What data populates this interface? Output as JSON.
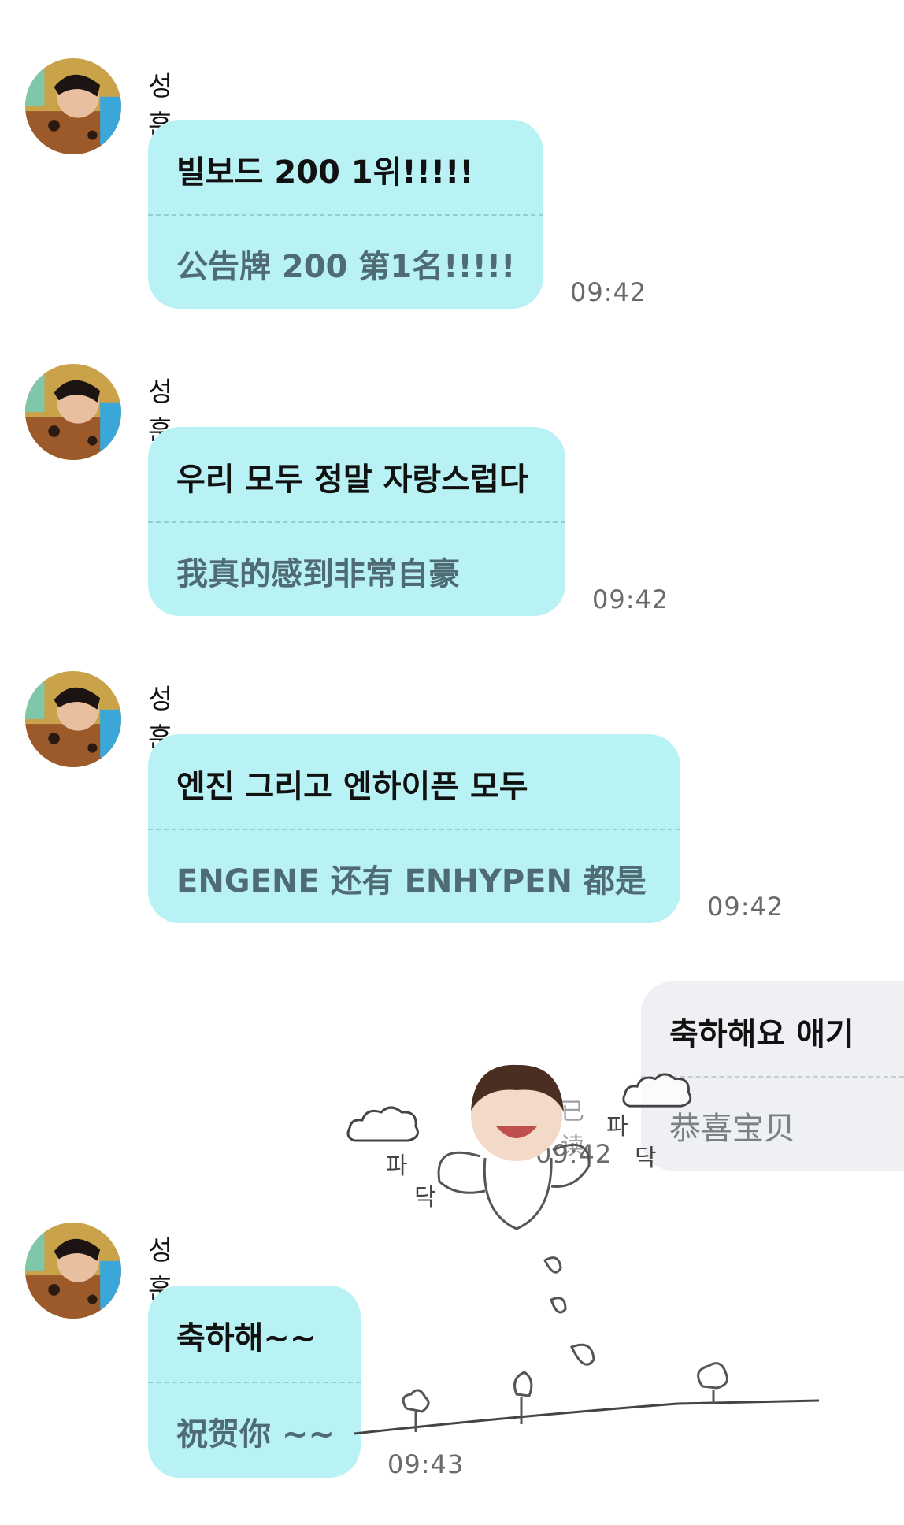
{
  "messages": [
    {
      "sender": "성훈",
      "line1": "빌보드 200 1위!!!!!",
      "line2": "公告牌 200 第1名!!!!!",
      "time": "09:42"
    },
    {
      "sender": "성훈",
      "line1": "우리 모두 정말 자랑스럽다",
      "line2": "我真的感到非常自豪",
      "time": "09:42"
    },
    {
      "sender": "성훈",
      "line1": "엔진 그리고 엔하이픈 모두",
      "line2": "ENGENE 还有 ENHYPEN 都是",
      "time": "09:42"
    },
    {
      "sender": "성훈",
      "line1": "축하해~~",
      "line2": "祝贺你 ~~",
      "time": "09:43"
    }
  ],
  "outgoing": {
    "line1": "축하해요 애기",
    "line2": "恭喜宝贝",
    "read": "已读",
    "time": "09:42"
  },
  "sticker": {
    "text_left_top": "파",
    "text_left_bottom": "닥",
    "text_right_top": "파",
    "text_right_bottom": "닥"
  },
  "colors": {
    "incoming_bubble": "#b9f2f4",
    "outgoing_bubble": "#eef0f3"
  },
  "icons": [
    "avatar-photo",
    "cloud-sticker",
    "character-sticker"
  ]
}
